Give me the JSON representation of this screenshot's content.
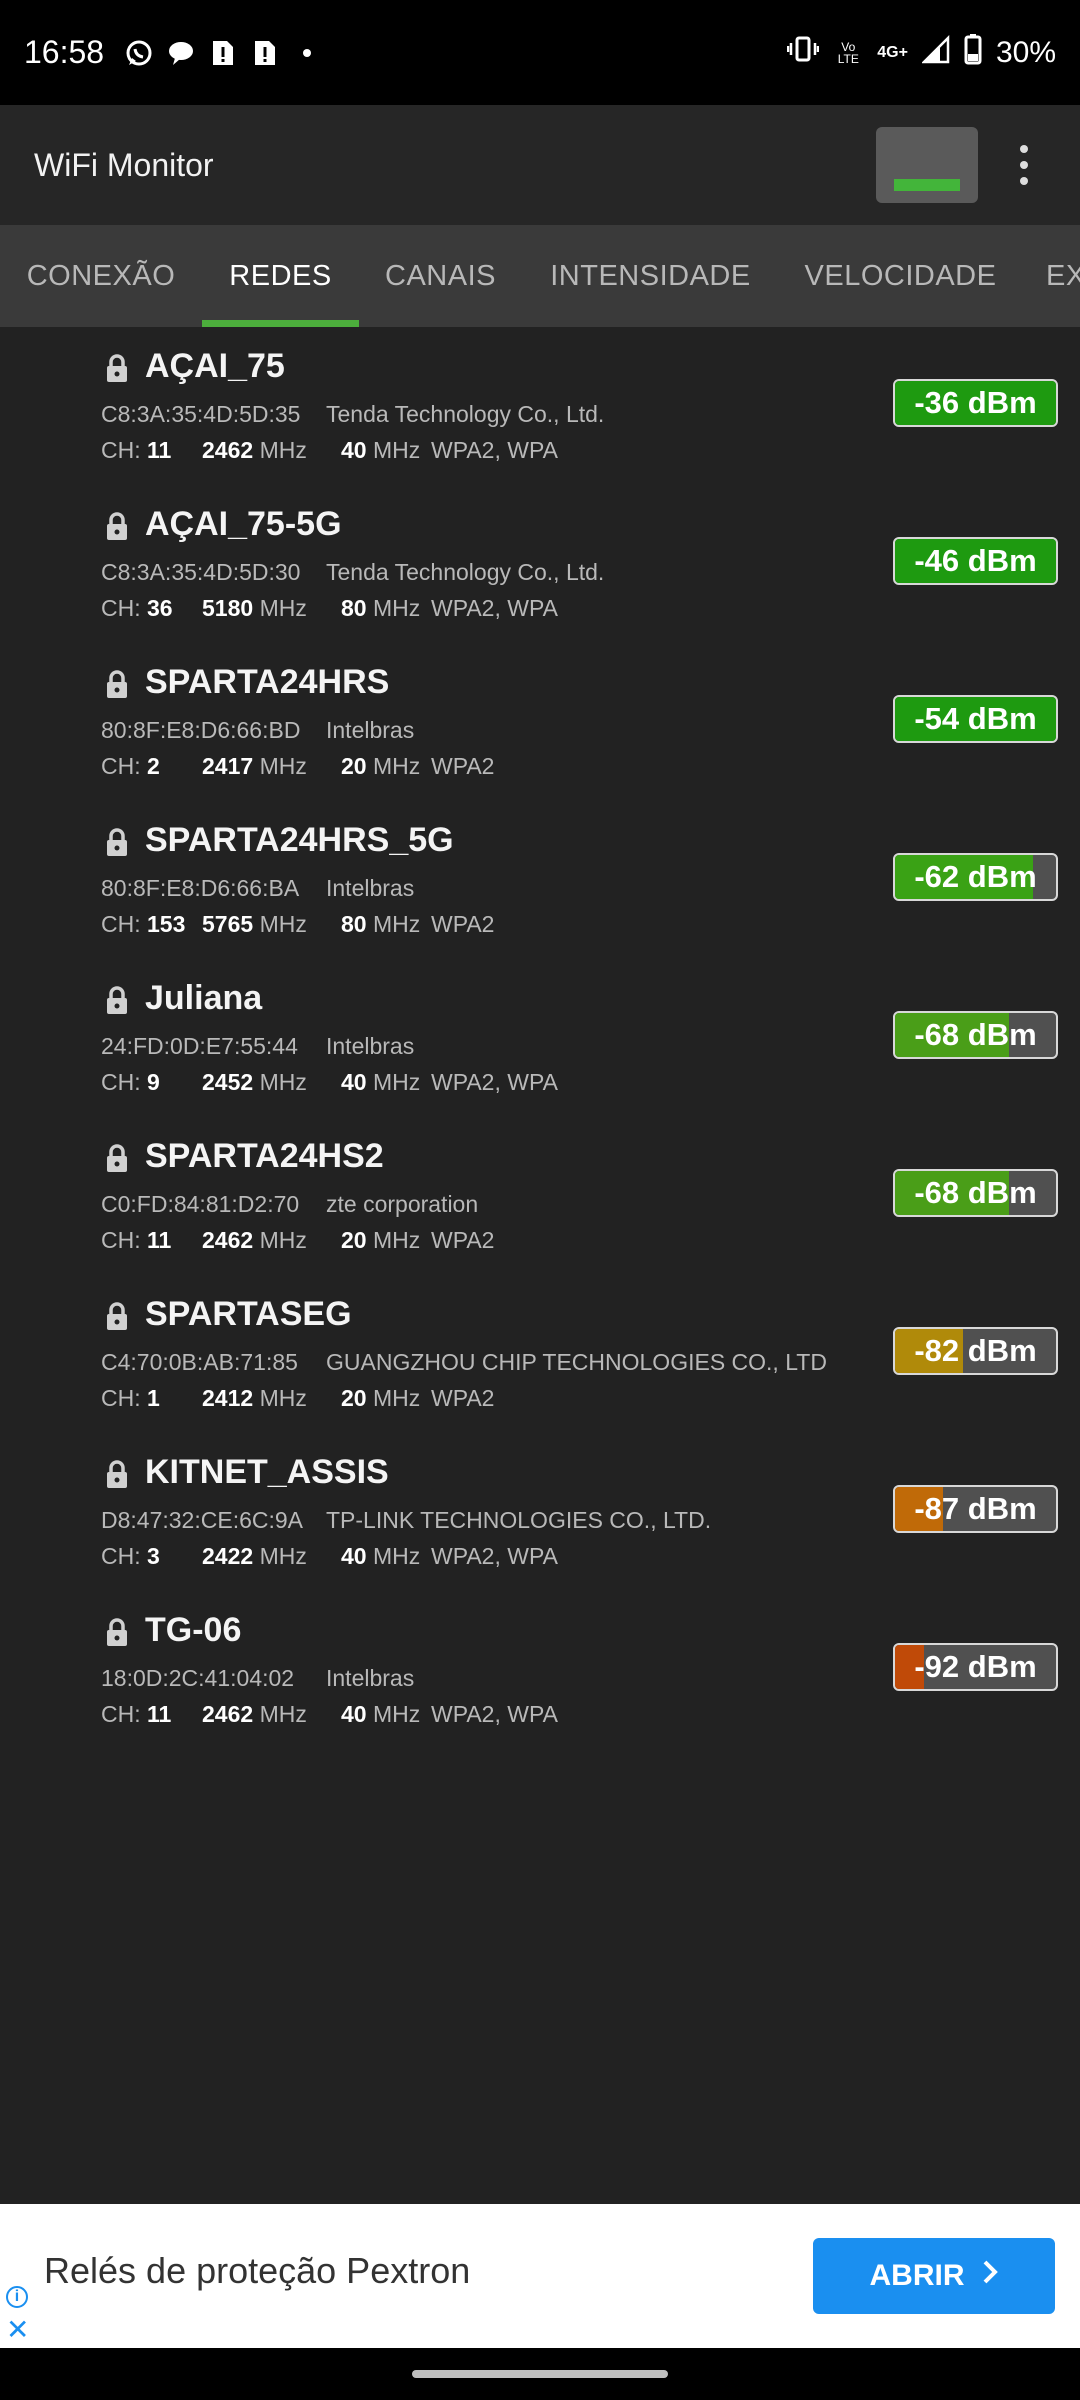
{
  "status_bar": {
    "time": "16:58",
    "battery": "30%",
    "net_label": "4G+",
    "volte_label": "Vo LTE",
    "notification_icons": [
      "whatsapp-icon",
      "chat-bubble-icon",
      "sim-alert-icon",
      "sim-alert-icon",
      "dot-icon"
    ]
  },
  "app_bar": {
    "title": "WiFi Monitor"
  },
  "tabs": [
    {
      "label": "CONEXÃO",
      "active": false
    },
    {
      "label": "REDES",
      "active": true
    },
    {
      "label": "CANAIS",
      "active": false
    },
    {
      "label": "INTENSIDADE",
      "active": false
    },
    {
      "label": "VELOCIDADE",
      "active": false
    },
    {
      "label": "EX",
      "active": false
    }
  ],
  "networks": [
    {
      "ssid": "AÇAI_75",
      "mac": "C8:3A:35:4D:5D:35",
      "vendor": "Tenda Technology Co., Ltd.",
      "ch_label": "CH:",
      "channel": "11",
      "freq": "2462",
      "freq_unit": "MHz",
      "width": "40",
      "width_unit": "MHz",
      "security": "WPA2, WPA",
      "signal_text": "-36 dBm",
      "signal_dbm": -36,
      "signal_fraction": 1.0,
      "signal_color": "#1e9a10"
    },
    {
      "ssid": "AÇAI_75-5G",
      "mac": "C8:3A:35:4D:5D:30",
      "vendor": "Tenda Technology Co., Ltd.",
      "ch_label": "CH:",
      "channel": "36",
      "freq": "5180",
      "freq_unit": "MHz",
      "width": "80",
      "width_unit": "MHz",
      "security": "WPA2, WPA",
      "signal_text": "-46 dBm",
      "signal_dbm": -46,
      "signal_fraction": 1.0,
      "signal_color": "#1e9a10"
    },
    {
      "ssid": "SPARTA24HRS",
      "mac": "80:8F:E8:D6:66:BD",
      "vendor": "Intelbras",
      "ch_label": "CH:",
      "channel": "2",
      "freq": "2417",
      "freq_unit": "MHz",
      "width": "20",
      "width_unit": "MHz",
      "security": "WPA2",
      "signal_text": "-54 dBm",
      "signal_dbm": -54,
      "signal_fraction": 1.0,
      "signal_color": "#1e9a10"
    },
    {
      "ssid": "SPARTA24HRS_5G",
      "mac": "80:8F:E8:D6:66:BA",
      "vendor": "Intelbras",
      "ch_label": "CH:",
      "channel": "153",
      "freq": "5765",
      "freq_unit": "MHz",
      "width": "80",
      "width_unit": "MHz",
      "security": "WPA2",
      "signal_text": "-62 dBm",
      "signal_dbm": -62,
      "signal_fraction": 0.86,
      "signal_color": "#3aa215"
    },
    {
      "ssid": "Juliana",
      "mac": "24:FD:0D:E7:55:44",
      "vendor": "Intelbras",
      "ch_label": "CH:",
      "channel": "9",
      "freq": "2452",
      "freq_unit": "MHz",
      "width": "40",
      "width_unit": "MHz",
      "security": "WPA2, WPA",
      "signal_text": "-68 dBm",
      "signal_dbm": -68,
      "signal_fraction": 0.71,
      "signal_color": "#4a9e18"
    },
    {
      "ssid": "SPARTA24HS2",
      "mac": "C0:FD:84:81:D2:70",
      "vendor": "zte corporation",
      "ch_label": "CH:",
      "channel": "11",
      "freq": "2462",
      "freq_unit": "MHz",
      "width": "20",
      "width_unit": "MHz",
      "security": "WPA2",
      "signal_text": "-68 dBm",
      "signal_dbm": -68,
      "signal_fraction": 0.71,
      "signal_color": "#4a9e18"
    },
    {
      "ssid": "SPARTASEG",
      "mac": "C4:70:0B:AB:71:85",
      "vendor": "GUANGZHOU CHIP TECHNOLOGIES CO., LTD",
      "ch_label": "CH:",
      "channel": "1",
      "freq": "2412",
      "freq_unit": "MHz",
      "width": "20",
      "width_unit": "MHz",
      "security": "WPA2",
      "signal_text": "-82 dBm",
      "signal_dbm": -82,
      "signal_fraction": 0.42,
      "signal_color": "#b08a0a"
    },
    {
      "ssid": "KITNET_ASSIS",
      "mac": "D8:47:32:CE:6C:9A",
      "vendor": "TP-LINK TECHNOLOGIES CO., LTD.",
      "ch_label": "CH:",
      "channel": "3",
      "freq": "2422",
      "freq_unit": "MHz",
      "width": "40",
      "width_unit": "MHz",
      "security": "WPA2, WPA",
      "signal_text": "-87 dBm",
      "signal_dbm": -87,
      "signal_fraction": 0.3,
      "signal_color": "#c06a08"
    },
    {
      "ssid": "TG-06",
      "mac": "18:0D:2C:41:04:02",
      "vendor": "Intelbras",
      "ch_label": "CH:",
      "channel": "11",
      "freq": "2462",
      "freq_unit": "MHz",
      "width": "40",
      "width_unit": "MHz",
      "security": "WPA2, WPA",
      "signal_text": "-92 dBm",
      "signal_dbm": -92,
      "signal_fraction": 0.18,
      "signal_color": "#c04a08"
    }
  ],
  "ad": {
    "text": "Relés de proteção Pextron",
    "button_label": "ABRIR"
  }
}
